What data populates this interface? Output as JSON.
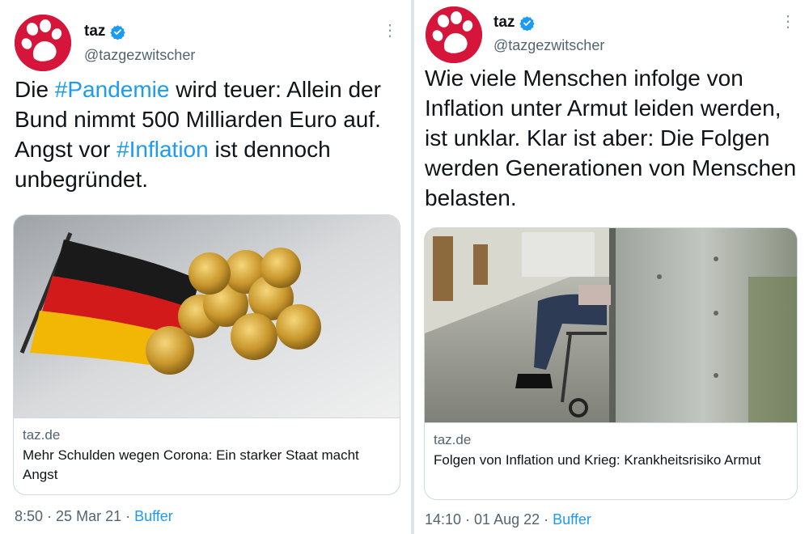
{
  "tweets": [
    {
      "name": "taz",
      "handle": "@tazgezwitscher",
      "text_parts": [
        "Die ",
        "#Pandemie",
        " wird teuer: Allein der Bund nimmt 500 Milliarden Euro auf. Angst vor ",
        "#Inflation",
        " ist dennoch unbegründet."
      ],
      "card": {
        "domain": "taz.de",
        "title": "Mehr Schulden wegen Corona: Ein starker Staat macht Angst"
      },
      "time": "8:50",
      "date": "25 Mar 21",
      "source": "Buffer"
    },
    {
      "name": "taz",
      "handle": "@tazgezwitscher",
      "text": "Wie viele Menschen infolge von Inflation unter Armut leiden werden, ist unklar. Klar ist aber: Die Folgen werden Generationen von Menschen belasten.",
      "card": {
        "domain": "taz.de",
        "title": "Folgen von Inflation und Krieg: Krankheitsrisiko Armut"
      },
      "time": "14:10",
      "date": "01 Aug 22",
      "source": "Buffer"
    }
  ],
  "separator": "·",
  "icons": {
    "avatar": "paw-logo-icon",
    "verified": "verified-badge-icon",
    "more": "more-vertical-icon"
  },
  "colors": {
    "brand_red": "#d5163a",
    "link_blue": "#1d9bf0",
    "verified_blue": "#1d9bf0"
  }
}
